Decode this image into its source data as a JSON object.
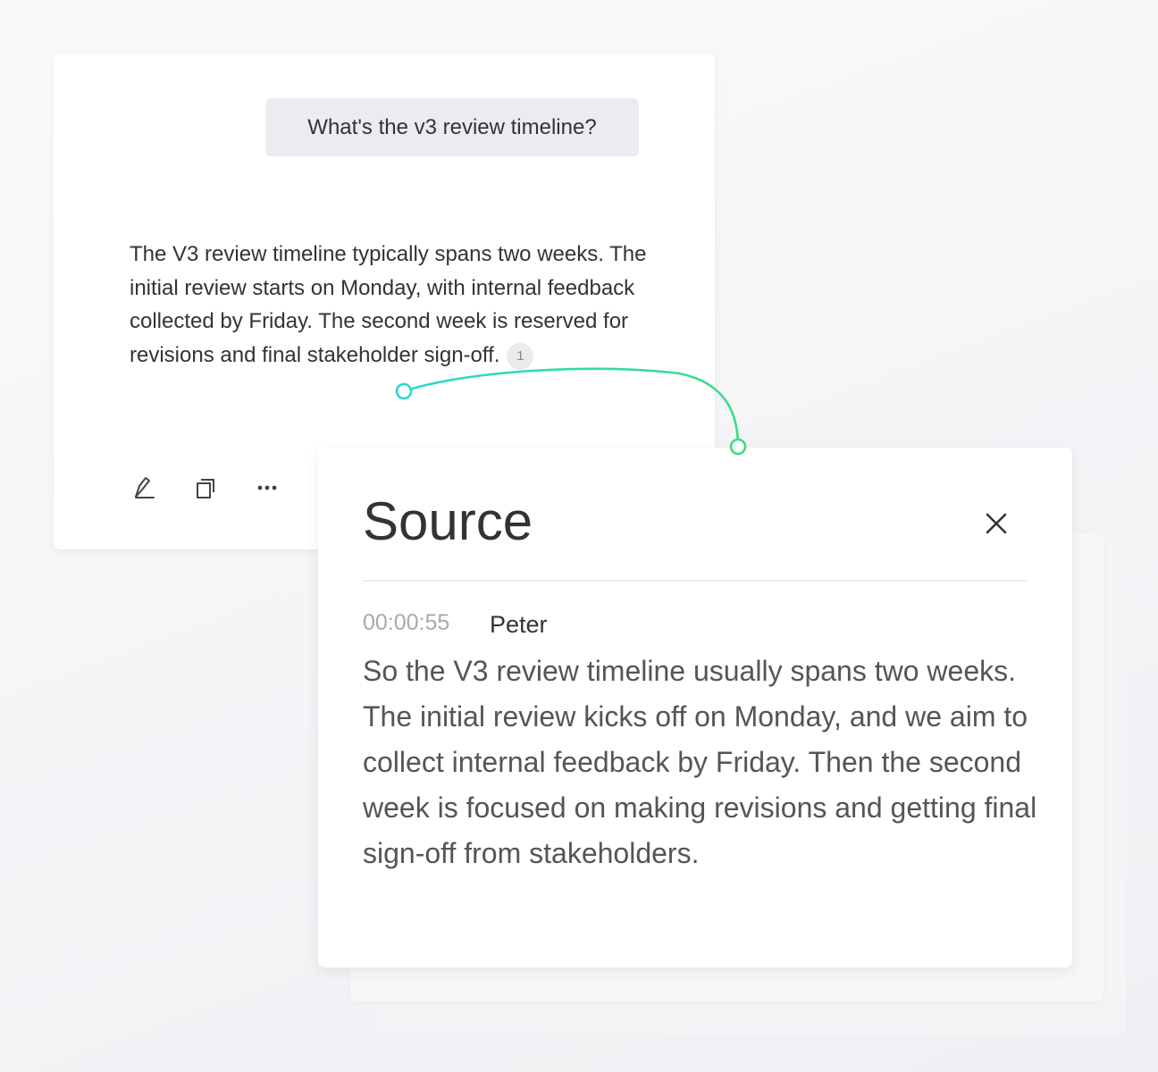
{
  "chat": {
    "question": "What's the v3 review timeline?",
    "answer": "The V3 review timeline typically spans two weeks. The initial review starts on Monday, with internal feedback collected by Friday. The second week is reserved for revisions and final stakeholder sign-off.",
    "citation_number": "1",
    "actions": [
      {
        "name": "edit-icon"
      },
      {
        "name": "copy-icon"
      },
      {
        "name": "more-icon"
      }
    ]
  },
  "source_panel": {
    "title": "Source",
    "timestamp": "00:00:55",
    "speaker": "Peter",
    "text": "So the V3 review timeline usually spans two weeks. The initial review kicks off on Monday, and we aim to collect internal feedback by Friday. Then the second week is focused on making revisions and getting final sign-off from stakeholders.",
    "close_icon": "close-icon"
  },
  "colors": {
    "connector_start": "#2ed6d0",
    "connector_end": "#3ddc84"
  }
}
